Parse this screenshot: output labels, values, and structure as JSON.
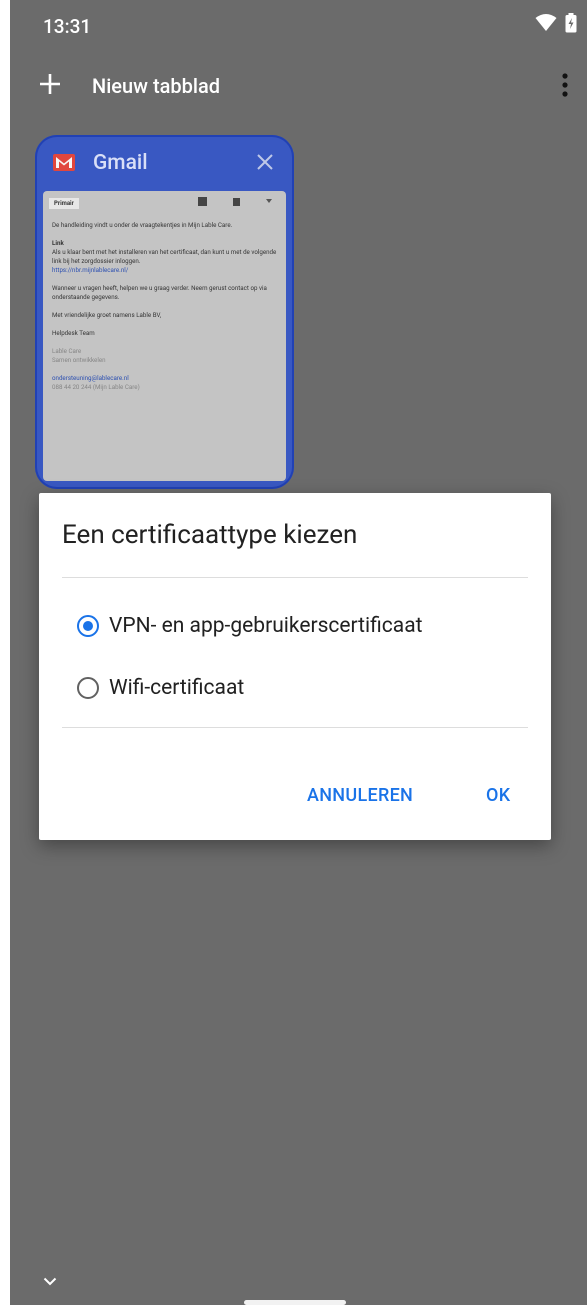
{
  "status_bar": {
    "time": "13:31",
    "icons": [
      "wifi-icon",
      "battery-charging-icon"
    ]
  },
  "toolbar": {
    "new_tab_label": "Nieuw tabblad"
  },
  "tab_card": {
    "title": "Gmail",
    "preview": {
      "tab_label": "Primair",
      "line1": "De handleiding vindt u onder de vraagtekentjes in Mijn Lable Care.",
      "link_heading": "Link",
      "line2": "Als u klaar bent met het installeren van het certificaat, dan kunt u met de volgende link bij het zorgdossier inloggen.",
      "url": "https://nbr.mijnlablecare.nl/",
      "line3": "Wanneer u vragen heeft, helpen we u graag verder. Neem gerust contact op via onderstaande gegevens.",
      "line4": "Met vriendelijke groet namens Lable BV,",
      "line5": "Helpdesk Team",
      "company": "Lable Care",
      "slogan": "Samen ontwikkelen",
      "email": "ondersteuning@lablecare.nl",
      "phone": "088 44 20 244 (Mijn Lable Care)"
    }
  },
  "dialog": {
    "title": "Een certificaattype kiezen",
    "options": [
      {
        "label": "VPN- en app-gebruikerscertificaat",
        "selected": true
      },
      {
        "label": "Wifi-certificaat",
        "selected": false
      }
    ],
    "cancel_label": "ANNULEREN",
    "ok_label": "OK"
  },
  "colors": {
    "accent": "#1a73e8",
    "scrim": "#6b6b6b",
    "gmail_card": "#3757c7"
  }
}
